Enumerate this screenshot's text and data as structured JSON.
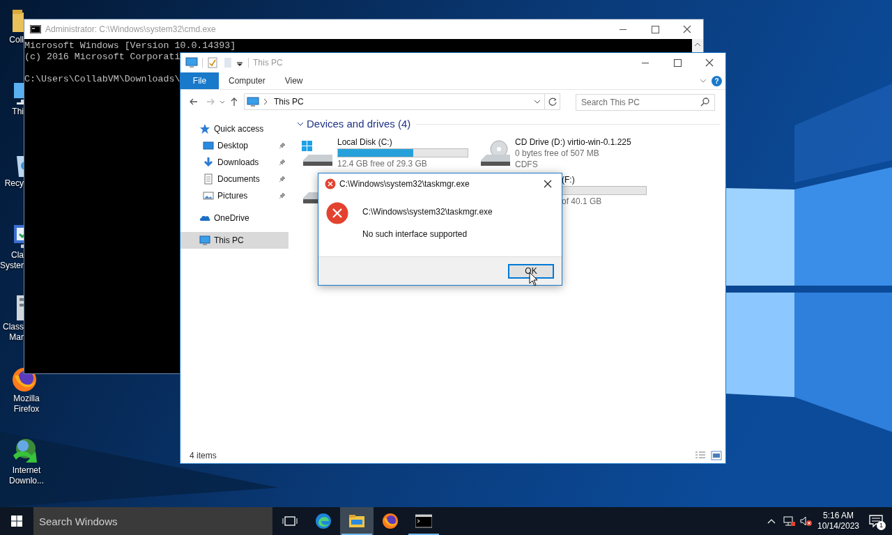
{
  "desktop_icons": [
    {
      "kind": "folder",
      "lines": [
        "Coll"
      ]
    },
    {
      "kind": "computer",
      "lines": [
        "Thi"
      ]
    },
    {
      "kind": "recycle",
      "lines": [
        "Recy"
      ]
    },
    {
      "kind": "monitor",
      "lines": [
        "Cla",
        "Syster"
      ]
    },
    {
      "kind": "server",
      "lines": [
        "Class",
        "Mar"
      ]
    },
    {
      "kind": "firefox",
      "lines": [
        "Mozilla",
        "Firefox"
      ]
    },
    {
      "kind": "downloader",
      "lines": [
        "Internet",
        "Downlo..."
      ]
    }
  ],
  "cmd_window": {
    "title": "Administrator: C:\\Windows\\system32\\cmd.exe",
    "lines": [
      "Microsoft Windows [Version 10.0.14393]",
      "(c) 2016 Microsoft Corporati"
    ],
    "prompt": "C:\\Users\\CollabVM\\Downloads\\"
  },
  "explorer": {
    "title": "This PC",
    "help": "?",
    "ribbon_tabs": [
      {
        "label": "File",
        "selected": true
      },
      {
        "label": "Computer",
        "selected": false
      },
      {
        "label": "View",
        "selected": false
      }
    ],
    "address": "This PC",
    "search": {
      "placeholder": "Search This PC"
    },
    "navigation": [
      {
        "kind": "star",
        "label": "Quick access",
        "selected": false,
        "children": [
          {
            "kind": "desktop",
            "label": "Desktop",
            "pinned": true,
            "selected": false
          },
          {
            "kind": "download",
            "label": "Downloads",
            "pinned": true,
            "selected": false
          },
          {
            "kind": "document",
            "label": "Documents",
            "pinned": true,
            "selected": false
          },
          {
            "kind": "picture",
            "label": "Pictures",
            "pinned": true,
            "selected": false
          }
        ]
      },
      {
        "kind": "cloud",
        "label": "OneDrive",
        "selected": false
      },
      {
        "kind": "computer",
        "label": "This PC",
        "selected": true
      }
    ],
    "group": {
      "label": "Devices and drives (4)",
      "expanded": true
    },
    "drives": [
      {
        "kind": "system",
        "label": "Local Disk (C:)",
        "level": 0.58,
        "info": "12.4 GB free of 29.3 GB"
      },
      {
        "kind": "optical",
        "label": "CD Drive (D:) virtio-win-0.1.225",
        "info": "0 bytes free of 507 MB",
        "filesystem": "CDFS"
      },
      {
        "kind": "disk"
      },
      {
        "kind": "partial",
        "label": "(F:)",
        "info": "of 40.1 GB"
      }
    ],
    "status": "4 items"
  },
  "dialog": {
    "title": "C:\\Windows\\system32\\taskmgr.exe",
    "path": "C:\\Windows\\system32\\taskmgr.exe",
    "message": "No such interface supported",
    "button": "OK"
  },
  "taskbar": {
    "search": {
      "placeholder": "Search Windows"
    },
    "apps": [
      {
        "kind": "edge",
        "active": false,
        "running": false
      },
      {
        "kind": "explorer",
        "active": true,
        "running": true
      },
      {
        "kind": "firefox",
        "active": false,
        "running": false
      },
      {
        "kind": "cmd",
        "active": false,
        "running": true
      }
    ],
    "time": "5:16 AM",
    "date": "10/14/2023",
    "notifications": "1"
  }
}
